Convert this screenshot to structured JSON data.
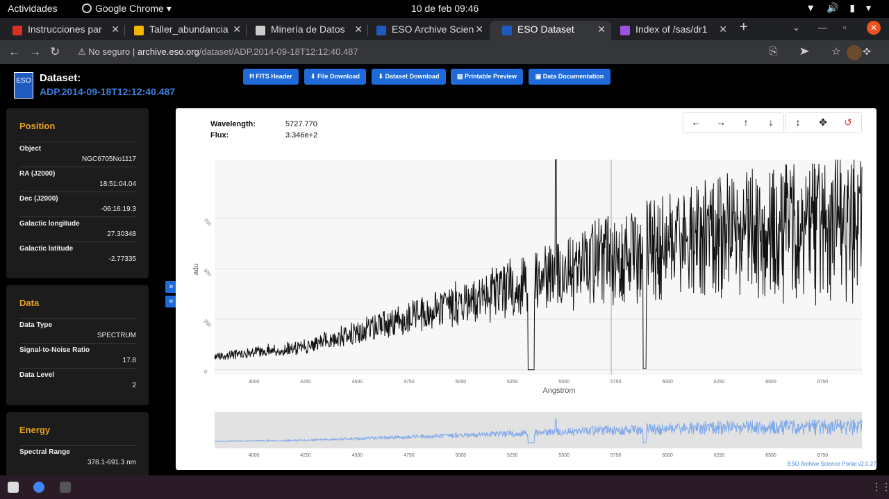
{
  "system": {
    "activities": "Actividades",
    "app_name": "Google Chrome",
    "clock": "10 de feb  09:46"
  },
  "tabs": [
    {
      "title": "Instrucciones par",
      "icon": "gmail-icon",
      "color": "#d93025"
    },
    {
      "title": "Taller_abundancia",
      "icon": "drive-icon",
      "color": "#f4b400"
    },
    {
      "title": "Minería de Datos",
      "icon": "classroom-icon",
      "color": "#cccccc"
    },
    {
      "title": "ESO Archive Scien",
      "icon": "eso-icon",
      "color": "#1f5bbf"
    },
    {
      "title": "ESO Dataset",
      "icon": "eso-icon",
      "color": "#1f5bbf"
    },
    {
      "title": "Index of /sas/dr1",
      "icon": "folder-icon",
      "color": "#9b51e0"
    }
  ],
  "omnibar": {
    "security": "No seguro",
    "url_host": "archive.eso.org",
    "url_path": "/dataset/ADP.2014-09-18T12:12:40.487"
  },
  "header": {
    "dataset_label": "Dataset:",
    "dataset_id": "ADP.2014-09-18T12:12:40.487",
    "logo_text": "ESO",
    "buttons": [
      "FITS Header",
      "File Download",
      "Dataset Download",
      "Printable Preview",
      "Data Documentation"
    ]
  },
  "position": {
    "title": "Position",
    "rows": [
      {
        "k": "Object",
        "v": "NGC6705No1117"
      },
      {
        "k": "RA (J2000)",
        "v": "18:51:04.04"
      },
      {
        "k": "Dec (J2000)",
        "v": "-06:16:19.3"
      },
      {
        "k": "Galactic longitude",
        "v": "27.30348"
      },
      {
        "k": "Galactic latitude",
        "v": "-2.77335"
      }
    ]
  },
  "data_panel": {
    "title": "Data",
    "rows": [
      {
        "k": "Data Type",
        "v": "SPECTRUM"
      },
      {
        "k": "Signal-to-Noise Ratio",
        "v": "17.8"
      },
      {
        "k": "Data Level",
        "v": "2"
      }
    ]
  },
  "energy": {
    "title": "Energy",
    "rows": [
      {
        "k": "Spectral Range",
        "v": "378.1-691.3 nm"
      }
    ]
  },
  "readout": {
    "wavelength_label": "Wavelength:",
    "wavelength_value": "5727.770",
    "flux_label": "Flux:",
    "flux_value": "3.346e+2"
  },
  "credit": "ESO Archive Science Portal v2.0.27",
  "chart_data": {
    "type": "line",
    "xlabel": "Angstrom",
    "ylabel": "adu",
    "xlim": [
      3810,
      6940
    ],
    "ylim": [
      -25,
      1040
    ],
    "xticks": [
      4000,
      4250,
      4500,
      4750,
      5000,
      5250,
      5500,
      5750,
      6000,
      6250,
      6500,
      6750
    ],
    "yticks": [
      0,
      250,
      500,
      750
    ],
    "cursor_x": 5727.77,
    "line_color": "#111111",
    "overview_color": "#7fa9ea",
    "trend": [
      [
        3810,
        80
      ],
      [
        4250,
        140
      ],
      [
        4750,
        330
      ],
      [
        5250,
        530
      ],
      [
        5750,
        750
      ],
      [
        6250,
        920
      ],
      [
        6940,
        1040
      ]
    ]
  }
}
